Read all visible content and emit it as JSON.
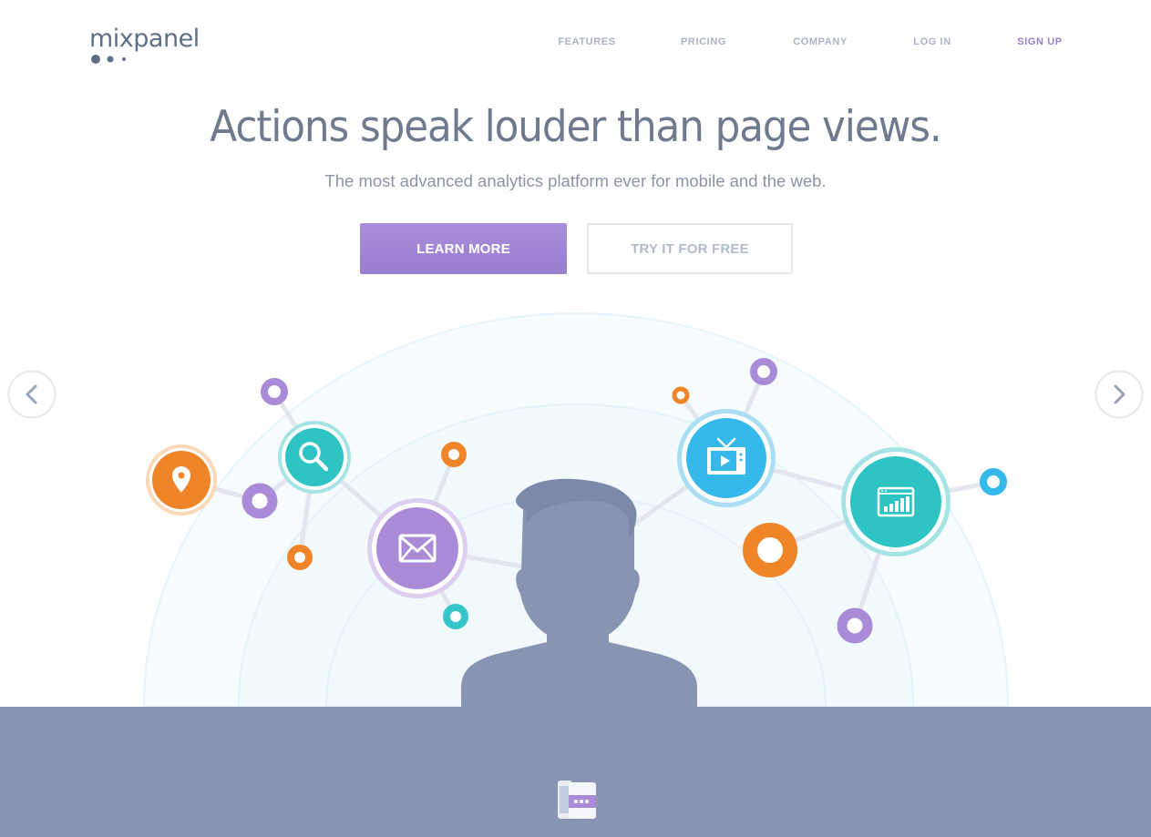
{
  "header": {
    "logo_text": "mixpanel",
    "nav": [
      {
        "label": "FEATURES",
        "active": false
      },
      {
        "label": "PRICING",
        "active": false
      },
      {
        "label": "COMPANY",
        "active": false
      },
      {
        "label": "LOG IN",
        "active": false
      },
      {
        "label": "SIGN UP",
        "active": true
      }
    ]
  },
  "hero": {
    "headline": "Actions speak louder than page views.",
    "subheadline": "The most advanced analytics platform ever for mobile and the web.",
    "primary_button": "LEARN MORE",
    "secondary_button": "TRY IT FOR FREE"
  },
  "carousel": {
    "prev_icon": "chevron-left-icon",
    "next_icon": "chevron-right-icon"
  },
  "illustration": {
    "icons": [
      "location-pin-icon",
      "search-icon",
      "mail-icon",
      "tv-icon",
      "browser-chart-icon"
    ]
  },
  "colors": {
    "accent_purple": "#9b7fd4",
    "orange": "#f08428",
    "teal": "#2ec4c4",
    "blue": "#35b8ea",
    "slate": "#8795b3",
    "text": "#6f7a8f"
  }
}
